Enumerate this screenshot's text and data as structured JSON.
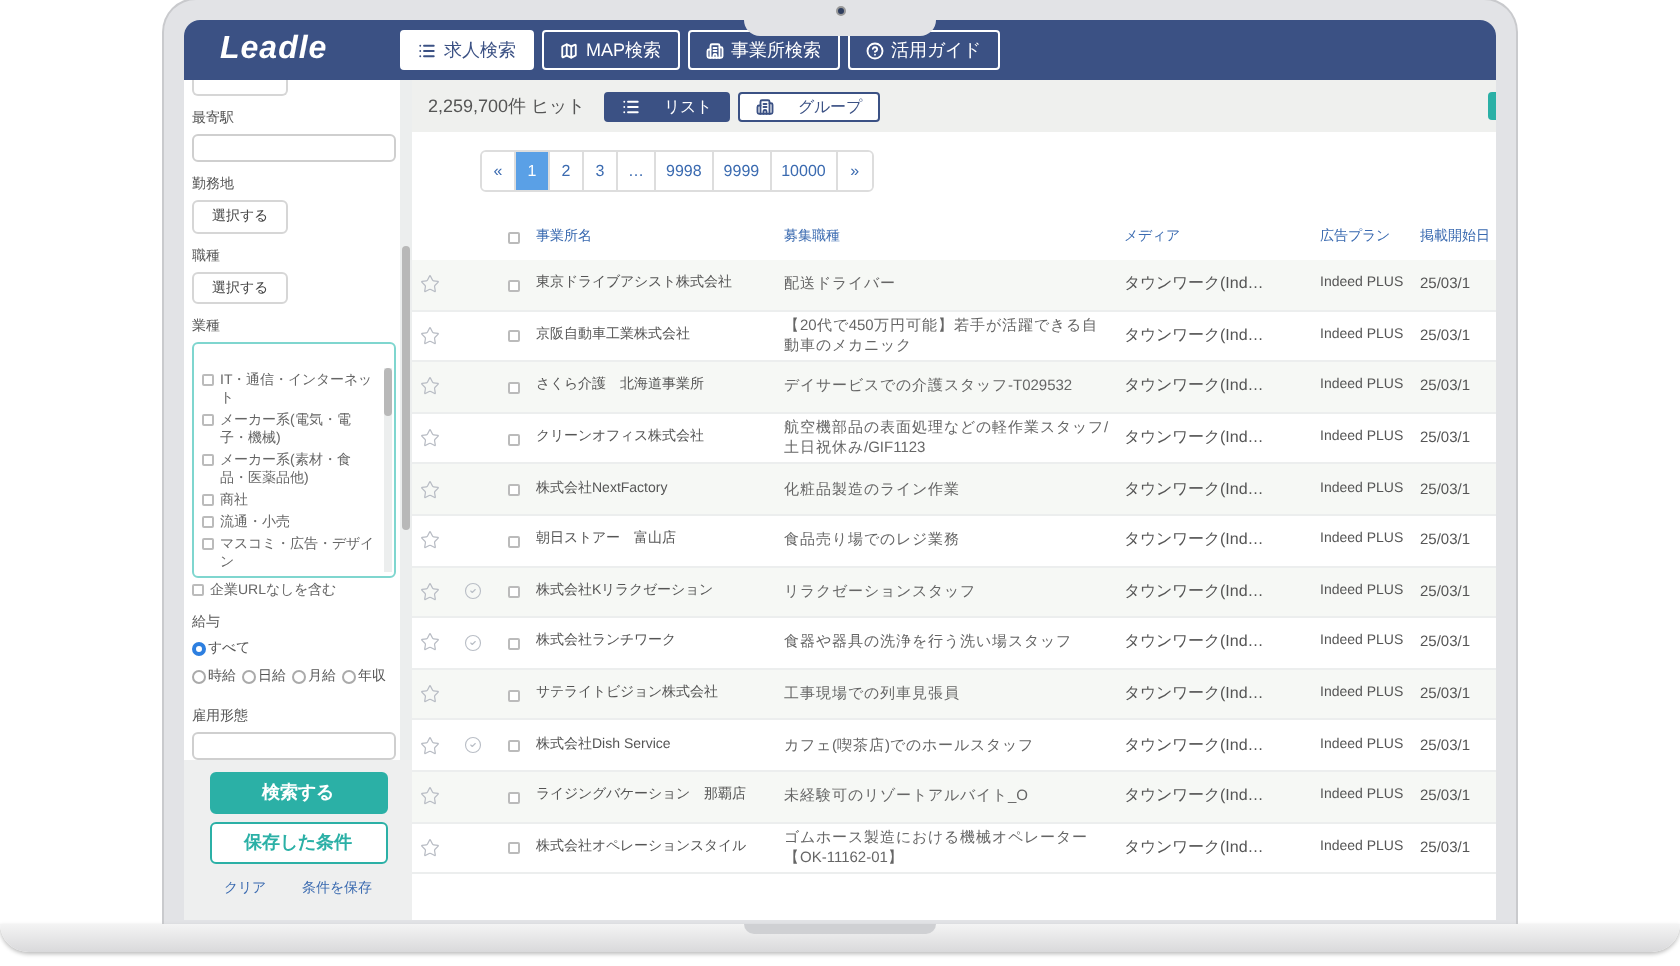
{
  "header": {
    "logo": "Leadle",
    "nav": [
      {
        "label": "求人検索",
        "selected": true
      },
      {
        "label": "MAP検索",
        "selected": false
      },
      {
        "label": "事業所検索",
        "selected": false
      },
      {
        "label": "活用ガイド",
        "selected": false
      }
    ]
  },
  "sidebar": {
    "sections": [
      {
        "kind": "cut_button"
      },
      {
        "kind": "input",
        "label": "最寄駅"
      },
      {
        "kind": "select",
        "label": "勤務地",
        "button": "選択する"
      },
      {
        "kind": "select",
        "label": "職種",
        "button": "選択する"
      },
      {
        "kind": "checklist",
        "label": "業種",
        "options": [
          {
            "label": "IT・通信・インターネット",
            "checked": false
          },
          {
            "label": "メーカー系(電気・電子・機械)",
            "checked": false
          },
          {
            "label": "メーカー系(素材・食品・医薬品他)",
            "checked": false
          },
          {
            "label": "商社",
            "checked": false
          },
          {
            "label": "流通・小売",
            "checked": false
          },
          {
            "label": "マスコミ・広告・デザイン",
            "checked": false
          }
        ]
      },
      {
        "kind": "checkbox",
        "label": "企業URLなしを含む",
        "checked": false
      },
      {
        "kind": "radio",
        "label": "給与",
        "rows": [
          [
            {
              "label": "すべて",
              "selected": true
            }
          ],
          [
            {
              "label": "時給",
              "selected": false
            },
            {
              "label": "日給",
              "selected": false
            },
            {
              "label": "月給",
              "selected": false
            },
            {
              "label": "年収",
              "selected": false
            }
          ]
        ]
      },
      {
        "kind": "input",
        "label": "雇用形態"
      }
    ],
    "search_button": "検索する",
    "saved_button": "保存した条件",
    "links": [
      "クリア",
      "条件を保存"
    ]
  },
  "toolbar": {
    "hits": "2,259,700件 ヒット",
    "views": [
      {
        "label": "リスト",
        "selected": true
      },
      {
        "label": "グループ",
        "selected": false
      }
    ]
  },
  "pagination": [
    {
      "label": "«",
      "selected": false
    },
    {
      "label": "1",
      "selected": true
    },
    {
      "label": "2",
      "selected": false
    },
    {
      "label": "3",
      "selected": false
    },
    {
      "label": "…",
      "selected": false
    },
    {
      "label": "9998",
      "selected": false
    },
    {
      "label": "9999",
      "selected": false
    },
    {
      "label": "10000",
      "selected": false
    },
    {
      "label": "»",
      "selected": false
    }
  ],
  "table": {
    "select_all": false,
    "columns": [
      "事業所名",
      "募集職種",
      "メディア",
      "広告プラン",
      "掲載開始日"
    ],
    "rows": [
      {
        "starred": false,
        "verified": false,
        "checked": false,
        "company": "東京ドライブアシスト株式会社",
        "job": "配送ドライバー",
        "media": "タウンワーク(Ind…",
        "plan": "Indeed PLUS",
        "date": "25/03/1"
      },
      {
        "starred": false,
        "verified": false,
        "checked": false,
        "company": "京阪自動車工業株式会社",
        "job": "【20代で450万円可能】若手が活躍できる自動車のメカニック",
        "media": "タウンワーク(Ind…",
        "plan": "Indeed PLUS",
        "date": "25/03/1"
      },
      {
        "starred": false,
        "verified": false,
        "checked": false,
        "company": "さくら介護　北海道事業所",
        "job": "デイサービスでの介護スタッフ-T029532",
        "media": "タウンワーク(Ind…",
        "plan": "Indeed PLUS",
        "date": "25/03/1"
      },
      {
        "starred": false,
        "verified": false,
        "checked": false,
        "company": "クリーンオフィス株式会社",
        "job": "航空機部品の表面処理などの軽作業スタッフ/土日祝休み/GIF1123",
        "media": "タウンワーク(Ind…",
        "plan": "Indeed PLUS",
        "date": "25/03/1"
      },
      {
        "starred": false,
        "verified": false,
        "checked": false,
        "company": "株式会社NextFactory",
        "job": "化粧品製造のライン作業",
        "media": "タウンワーク(Ind…",
        "plan": "Indeed PLUS",
        "date": "25/03/1"
      },
      {
        "starred": false,
        "verified": false,
        "checked": false,
        "company": "朝日ストアー　富山店",
        "job": "食品売り場でのレジ業務",
        "media": "タウンワーク(Ind…",
        "plan": "Indeed PLUS",
        "date": "25/03/1"
      },
      {
        "starred": false,
        "verified": true,
        "checked": false,
        "company": "株式会社Kリラクゼーション",
        "job": "リラクゼーションスタッフ",
        "media": "タウンワーク(Ind…",
        "plan": "Indeed PLUS",
        "date": "25/03/1"
      },
      {
        "starred": false,
        "verified": true,
        "checked": false,
        "company": "株式会社ランチワーク",
        "job": "食器や器具の洗浄を行う洗い場スタッフ",
        "media": "タウンワーク(Ind…",
        "plan": "Indeed PLUS",
        "date": "25/03/1"
      },
      {
        "starred": false,
        "verified": false,
        "checked": false,
        "company": "サテライトビジョン株式会社",
        "job": "工事現場での列車見張員",
        "media": "タウンワーク(Ind…",
        "plan": "Indeed PLUS",
        "date": "25/03/1"
      },
      {
        "starred": false,
        "verified": true,
        "checked": false,
        "company": "株式会社Dish Service",
        "job": "カフェ(喫茶店)でのホールスタッフ",
        "media": "タウンワーク(Ind…",
        "plan": "Indeed PLUS",
        "date": "25/03/1"
      },
      {
        "starred": false,
        "verified": false,
        "checked": false,
        "company": "ライジングバケーション　那覇店",
        "job": "未経験可のリゾートアルバイト_O",
        "media": "タウンワーク(Ind…",
        "plan": "Indeed PLUS",
        "date": "25/03/1"
      },
      {
        "starred": false,
        "verified": false,
        "checked": false,
        "company": "株式会社オペレーションスタイル",
        "job": "ゴムホース製造における機械オペレーター【OK-11162-01】",
        "media": "タウンワーク(Ind…",
        "plan": "Indeed PLUS",
        "date": "25/03/1"
      }
    ]
  }
}
